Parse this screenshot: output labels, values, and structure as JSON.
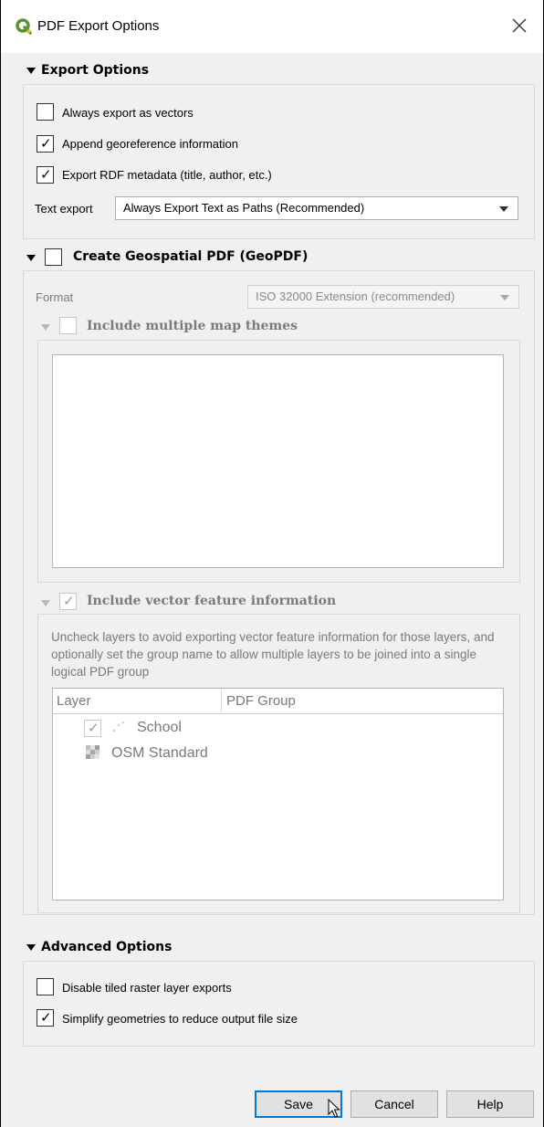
{
  "window": {
    "title": "PDF Export Options"
  },
  "export_options": {
    "header": "Export Options",
    "always_vectors": {
      "label": "Always export as vectors",
      "checked": false
    },
    "append_georef": {
      "label": "Append georeference information",
      "checked": true
    },
    "export_rdf": {
      "label": "Export RDF metadata (title, author, etc.)",
      "checked": true
    },
    "text_export": {
      "label": "Text export",
      "value": "Always Export Text as Paths (Recommended)"
    }
  },
  "geopdf": {
    "header": "Create Geospatial PDF (GeoPDF)",
    "checked": false,
    "format_label": "Format",
    "format_value": "ISO 32000 Extension (recommended)",
    "map_themes": {
      "header": "Include multiple map themes",
      "checked": false
    },
    "vector_info": {
      "header": "Include vector feature information",
      "checked": true,
      "description": "Uncheck layers to avoid exporting vector feature information for those layers, and optionally set the group name to allow multiple layers to be joined into a single logical PDF group",
      "columns": [
        "Layer",
        "PDF Group"
      ],
      "layers": [
        {
          "name": "School",
          "checked": true,
          "icon": "point-layer-icon"
        },
        {
          "name": "OSM Standard",
          "icon": "raster-layer-icon"
        }
      ]
    }
  },
  "advanced": {
    "header": "Advanced Options",
    "disable_tiled": {
      "label": "Disable tiled raster layer exports",
      "checked": false
    },
    "simplify": {
      "label": "Simplify geometries to reduce output file size",
      "checked": true
    }
  },
  "buttons": {
    "save": "Save",
    "cancel": "Cancel",
    "help": "Help"
  },
  "check_glyph": "✓",
  "colors": {
    "qgis_green": "#589632",
    "accent": "#0078d7"
  }
}
